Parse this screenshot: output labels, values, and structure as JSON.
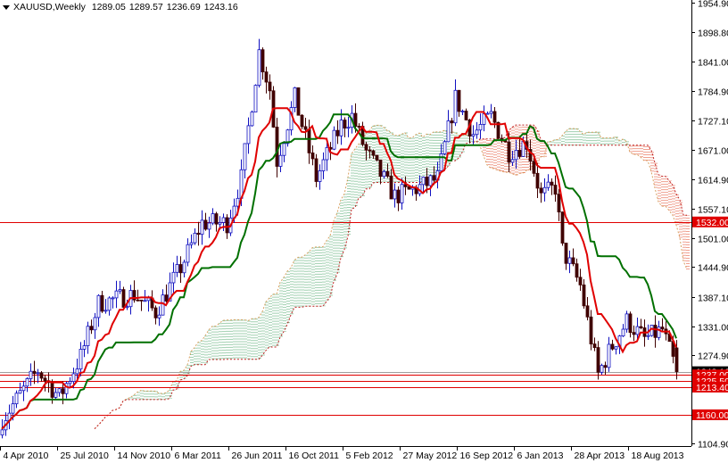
{
  "header": {
    "symbol": "XAUUSD,Weekly",
    "open": "1289.05",
    "high": "1289.57",
    "low": "1236.69",
    "close": "1243.16"
  },
  "chart_data": {
    "type": "candlestick",
    "title": "XAUUSD,Weekly",
    "indicators": [
      "Ichimoku Kinko Hyo (tenkan red, kijun green, cloud hatched)"
    ],
    "ylim": [
      1104.9,
      1954.9
    ],
    "y_ticks": [
      "1954.90",
      "1898.80",
      "1841.00",
      "1784.90",
      "1727.10",
      "1671.00",
      "1614.90",
      "1557.10",
      "1501.00",
      "1444.90",
      "1387.10",
      "1331.00",
      "1274.90",
      "1104.90"
    ],
    "x_ticks": [
      {
        "week": 0,
        "label": "4 Apr 2010"
      },
      {
        "week": 16,
        "label": "25 Jul 2010"
      },
      {
        "week": 32,
        "label": "14 Nov 2010"
      },
      {
        "week": 48,
        "label": "6 Mar 2011"
      },
      {
        "week": 64,
        "label": "26 Jun 2011"
      },
      {
        "week": 80,
        "label": "16 Oct 2011"
      },
      {
        "week": 96,
        "label": "5 Feb 2012"
      },
      {
        "week": 112,
        "label": "27 May 2012"
      },
      {
        "week": 128,
        "label": "16 Sep 2012"
      },
      {
        "week": 144,
        "label": "6 Jan 2013"
      },
      {
        "week": 160,
        "label": "28 Apr 2013"
      },
      {
        "week": 176,
        "label": "18 Aug 2013"
      }
    ],
    "weeks": 190,
    "price_path_anchors": [
      [
        0,
        1151
      ],
      [
        10,
        1246
      ],
      [
        16,
        1194
      ],
      [
        22,
        1272
      ],
      [
        27,
        1375
      ],
      [
        37,
        1392
      ],
      [
        43,
        1358
      ],
      [
        50,
        1444
      ],
      [
        56,
        1530
      ],
      [
        63,
        1530
      ],
      [
        67,
        1616
      ],
      [
        72,
        1860
      ],
      [
        75,
        1788
      ],
      [
        77,
        1650
      ],
      [
        82,
        1771
      ],
      [
        88,
        1616
      ],
      [
        95,
        1719
      ],
      [
        98,
        1736
      ],
      [
        102,
        1667
      ],
      [
        110,
        1581
      ],
      [
        117,
        1599
      ],
      [
        122,
        1616
      ],
      [
        127,
        1771
      ],
      [
        132,
        1702
      ],
      [
        137,
        1736
      ],
      [
        142,
        1667
      ],
      [
        147,
        1685
      ],
      [
        151,
        1581
      ],
      [
        155,
        1599
      ],
      [
        157,
        1478
      ],
      [
        162,
        1409
      ],
      [
        167,
        1238
      ],
      [
        170,
        1281
      ],
      [
        175,
        1341
      ],
      [
        180,
        1306
      ],
      [
        185,
        1324
      ],
      [
        189,
        1243.16
      ]
    ],
    "horizontal_lines": [
      {
        "label": "1532.00",
        "price": 1532.0,
        "color": "#e00000"
      },
      {
        "label": "1243.16",
        "price": 1243.16,
        "color": "#a0a0a0",
        "label_bg": "#000000"
      },
      {
        "label": "1237.00",
        "price": 1237.0,
        "color": "#e00000"
      },
      {
        "label": "1225.50",
        "price": 1225.5,
        "color": "#e00000"
      },
      {
        "label": "1213.40",
        "price": 1213.4,
        "color": "#e00000"
      },
      {
        "label": "1160.00",
        "price": 1160.0,
        "color": "#e00000"
      }
    ],
    "colors": {
      "up": "#1010c0",
      "down": "#400000",
      "tenkan": "#e00000",
      "kijun": "#007000",
      "cloud_up": "#40a060",
      "cloud_down": "#e04020"
    }
  }
}
